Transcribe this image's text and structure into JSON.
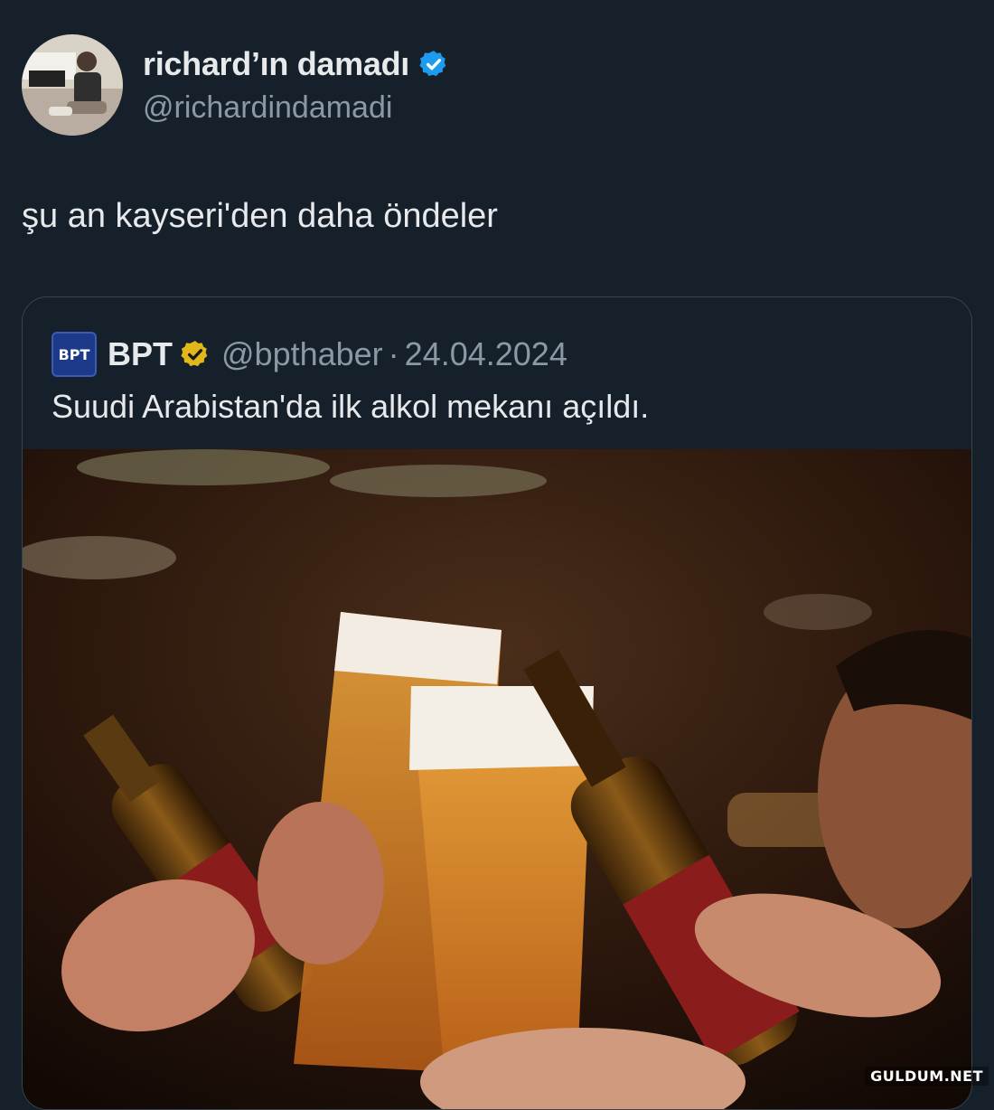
{
  "tweet": {
    "display_name": "richard’ın damadı",
    "handle": "@richardindamadi",
    "text": "şu an kayseri'den daha öndeler",
    "avatar_icon": "profile-photo",
    "verified_icon": "verified-badge-icon"
  },
  "quoted_tweet": {
    "logo_text": "BPT",
    "display_name": "BPT",
    "handle": "@bpthaber",
    "separator": "·",
    "date": "24.04.2024",
    "text": "Suudi Arabistan'da ilk alkol mekanı açıldı.",
    "verified_icon": "gold-verified-badge-icon",
    "media_description": "beer-toast-photo"
  },
  "watermark": "GULDUM.NET",
  "colors": {
    "background": "#15202b",
    "verified_blue": "#1d9bf0",
    "verified_gold": "#e2b719",
    "muted": "#8b98a5"
  }
}
